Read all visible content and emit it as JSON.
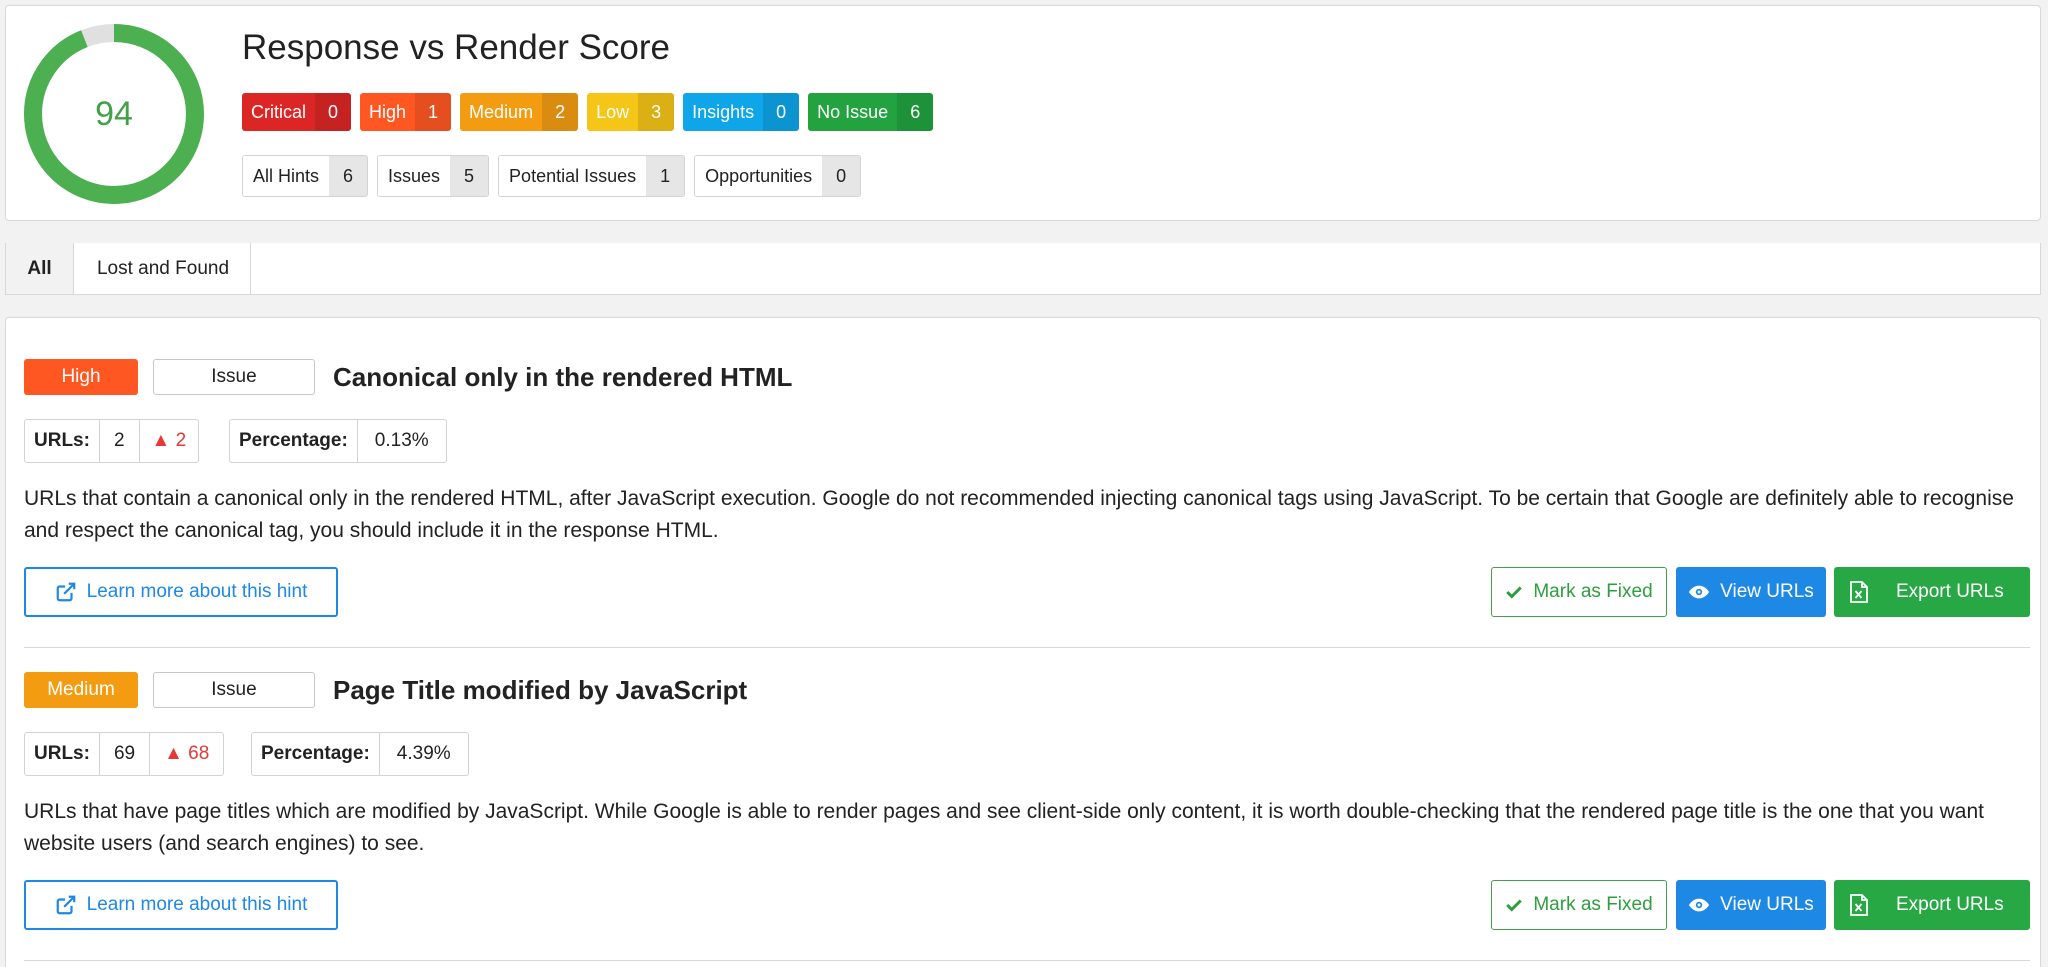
{
  "score": {
    "value": "94",
    "fraction": 0.94,
    "title": "Response vs Render Score",
    "ring_color": "#4caf50",
    "track_color": "#e0e0e0"
  },
  "severities": [
    {
      "label": "Critical",
      "count": "0",
      "color": "#dc2626"
    },
    {
      "label": "High",
      "count": "1",
      "color": "#ff5722"
    },
    {
      "label": "Medium",
      "count": "2",
      "color": "#f39c12"
    },
    {
      "label": "Low",
      "count": "3",
      "color": "#f5c518"
    },
    {
      "label": "Insights",
      "count": "0",
      "color": "#0ea5e9"
    },
    {
      "label": "No Issue",
      "count": "6",
      "color": "#22a340"
    }
  ],
  "hint_types": [
    {
      "label": "All Hints",
      "count": "6"
    },
    {
      "label": "Issues",
      "count": "5"
    },
    {
      "label": "Potential Issues",
      "count": "1"
    },
    {
      "label": "Opportunities",
      "count": "0"
    }
  ],
  "tabs": [
    {
      "label": "All",
      "active": true
    },
    {
      "label": "Lost and Found",
      "active": false
    }
  ],
  "hints": [
    {
      "severity": "High",
      "severity_color": "#ff5722",
      "type": "Issue",
      "title": "Canonical only in the rendered HTML",
      "urls_label": "URLs:",
      "urls": "2",
      "urls_change": "▲ 2",
      "percentage_label": "Percentage:",
      "percentage": "0.13%",
      "description": "URLs that contain a canonical only in the rendered HTML, after JavaScript execution. Google do not recommended injecting canonical tags using JavaScript. To be certain that Google are definitely able to recognise and respect the canonical tag, you should include it in the response HTML.",
      "learn_label": "Learn more about this hint",
      "fixed_label": "Mark as Fixed",
      "view_label": "View URLs",
      "export_label": "Export URLs"
    },
    {
      "severity": "Medium",
      "severity_color": "#f39c12",
      "type": "Issue",
      "title": "Page Title modified by JavaScript",
      "urls_label": "URLs:",
      "urls": "69",
      "urls_change": "▲ 68",
      "percentage_label": "Percentage:",
      "percentage": "4.39%",
      "description": "URLs that have page titles which are modified by JavaScript. While Google is able to render pages and see client-side only content, it is worth double-checking that the rendered page title is the one that you want website users (and search engines) to see.",
      "learn_label": "Learn more about this hint",
      "fixed_label": "Mark as Fixed",
      "view_label": "View URLs",
      "export_label": "Export URLs"
    }
  ]
}
